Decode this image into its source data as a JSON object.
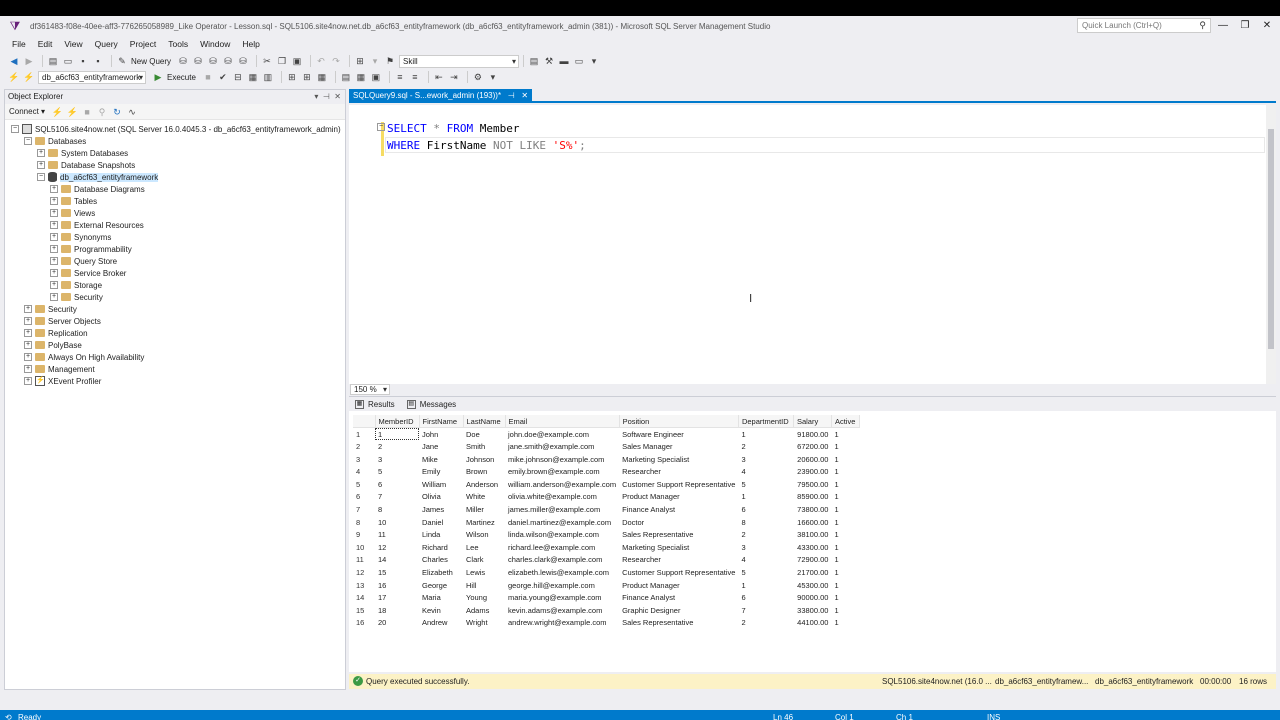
{
  "window": {
    "title": "df361483-f08e-40ee-aff3-776265058989_Like Operator - Lesson.sql - SQL5106.site4now.net.db_a6cf63_entityframework (db_a6cf63_entityframework_admin (381)) - Microsoft SQL Server Management Studio",
    "quick_launch_placeholder": "Quick Launch (Ctrl+Q)"
  },
  "menu": [
    "File",
    "Edit",
    "View",
    "Query",
    "Project",
    "Tools",
    "Window",
    "Help"
  ],
  "toolbar": {
    "new_query_label": "New Query",
    "search_combo_value": "Skill",
    "database_combo_value": "db_a6cf63_entityframework",
    "execute_label": "Execute"
  },
  "object_explorer": {
    "title": "Object Explorer",
    "connect_label": "Connect ▾",
    "nodes": [
      {
        "label": "SQL5106.site4now.net (SQL Server 16.0.4045.3 - db_a6cf63_entityframework_admin)",
        "expander": "−"
      },
      {
        "label": "Databases",
        "expander": "−"
      },
      {
        "label": "System Databases",
        "expander": "+"
      },
      {
        "label": "Database Snapshots",
        "expander": "+"
      },
      {
        "label": "db_a6cf63_entityframework",
        "expander": "−"
      },
      {
        "label": "Database Diagrams",
        "expander": "+"
      },
      {
        "label": "Tables",
        "expander": "+"
      },
      {
        "label": "Views",
        "expander": "+"
      },
      {
        "label": "External Resources",
        "expander": "+"
      },
      {
        "label": "Synonyms",
        "expander": "+"
      },
      {
        "label": "Programmability",
        "expander": "+"
      },
      {
        "label": "Query Store",
        "expander": "+"
      },
      {
        "label": "Service Broker",
        "expander": "+"
      },
      {
        "label": "Storage",
        "expander": "+"
      },
      {
        "label": "Security",
        "expander": "+"
      },
      {
        "label": "Security",
        "expander": "+"
      },
      {
        "label": "Server Objects",
        "expander": "+"
      },
      {
        "label": "Replication",
        "expander": "+"
      },
      {
        "label": "PolyBase",
        "expander": "+"
      },
      {
        "label": "Always On High Availability",
        "expander": "+"
      },
      {
        "label": "Management",
        "expander": "+"
      },
      {
        "label": "XEvent Profiler",
        "expander": "+"
      }
    ]
  },
  "editor": {
    "tab_label": "SQLQuery9.sql - S...ework_admin (193))*",
    "line1": {
      "kw1": "SELECT",
      "star": " * ",
      "kw2": "FROM",
      "table": " Member"
    },
    "line2": {
      "kw1": "WHERE",
      "col": " FirstName ",
      "kw2": "NOT LIKE",
      "str": "'S%'",
      "end": ";"
    },
    "zoom": "150 %"
  },
  "results": {
    "tabs": [
      "Results",
      "Messages"
    ],
    "columns": [
      "MemberID",
      "FirstName",
      "LastName",
      "Email",
      "Position",
      "DepartmentID",
      "Salary",
      "Active"
    ],
    "rows": [
      [
        "1",
        "1",
        "John",
        "Doe",
        "john.doe@example.com",
        "Software Engineer",
        "1",
        "91800.00",
        "1"
      ],
      [
        "2",
        "2",
        "Jane",
        "Smith",
        "jane.smith@example.com",
        "Sales Manager",
        "2",
        "67200.00",
        "1"
      ],
      [
        "3",
        "3",
        "Mike",
        "Johnson",
        "mike.johnson@example.com",
        "Marketing Specialist",
        "3",
        "20600.00",
        "1"
      ],
      [
        "4",
        "5",
        "Emily",
        "Brown",
        "emily.brown@example.com",
        "Researcher",
        "4",
        "23900.00",
        "1"
      ],
      [
        "5",
        "6",
        "William",
        "Anderson",
        "william.anderson@example.com",
        "Customer Support Representative",
        "5",
        "79500.00",
        "1"
      ],
      [
        "6",
        "7",
        "Olivia",
        "White",
        "olivia.white@example.com",
        "Product Manager",
        "1",
        "85900.00",
        "1"
      ],
      [
        "7",
        "8",
        "James",
        "Miller",
        "james.miller@example.com",
        "Finance Analyst",
        "6",
        "73800.00",
        "1"
      ],
      [
        "8",
        "10",
        "Daniel",
        "Martinez",
        "daniel.martinez@example.com",
        "Doctor",
        "8",
        "16600.00",
        "1"
      ],
      [
        "9",
        "11",
        "Linda",
        "Wilson",
        "linda.wilson@example.com",
        "Sales Representative",
        "2",
        "38100.00",
        "1"
      ],
      [
        "10",
        "12",
        "Richard",
        "Lee",
        "richard.lee@example.com",
        "Marketing Specialist",
        "3",
        "43300.00",
        "1"
      ],
      [
        "11",
        "14",
        "Charles",
        "Clark",
        "charles.clark@example.com",
        "Researcher",
        "4",
        "72900.00",
        "1"
      ],
      [
        "12",
        "15",
        "Elizabeth",
        "Lewis",
        "elizabeth.lewis@example.com",
        "Customer Support Representative",
        "5",
        "21700.00",
        "1"
      ],
      [
        "13",
        "16",
        "George",
        "Hill",
        "george.hill@example.com",
        "Product Manager",
        "1",
        "45300.00",
        "1"
      ],
      [
        "14",
        "17",
        "Maria",
        "Young",
        "maria.young@example.com",
        "Finance Analyst",
        "6",
        "90000.00",
        "1"
      ],
      [
        "15",
        "18",
        "Kevin",
        "Adams",
        "kevin.adams@example.com",
        "Graphic Designer",
        "7",
        "33800.00",
        "1"
      ],
      [
        "16",
        "20",
        "Andrew",
        "Wright",
        "andrew.wright@example.com",
        "Sales Representative",
        "2",
        "44100.00",
        "1"
      ]
    ]
  },
  "query_status": {
    "message": "Query executed successfully.",
    "server": "SQL5106.site4now.net (16.0 ...",
    "login": "db_a6cf63_entityframew...",
    "database": "db_a6cf63_entityframework",
    "elapsed": "00:00:00",
    "row_count": "16 rows"
  },
  "statusbar": {
    "state": "Ready",
    "line": "Ln 46",
    "col": "Col 1",
    "ch": "Ch 1",
    "mode": "INS"
  },
  "colors": {
    "accent": "#007acc",
    "keyword": "#0000ff",
    "string": "#ff0000",
    "status_bar_bg": "#fcf2c6"
  }
}
